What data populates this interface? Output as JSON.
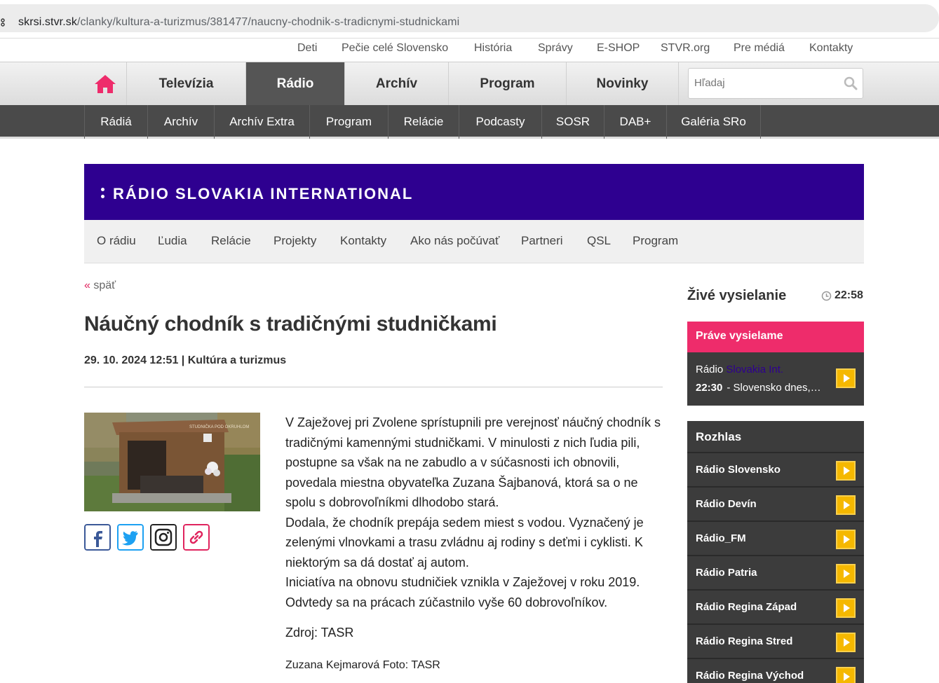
{
  "browser": {
    "url_host": "skrsi.stvr.sk",
    "url_path": "/clanky/kultura-a-turizmus/381477/naucny-chodnik-s-tradicnymi-studnickami"
  },
  "toplinks": [
    "Deti",
    "Pečie celé Slovensko",
    "História",
    "Správy",
    "E-SHOP",
    "STVR.org",
    "Pre médiá",
    "Kontakty"
  ],
  "mainnav": {
    "items": [
      "Televízia",
      "Rádio",
      "Archív",
      "Program",
      "Novinky"
    ],
    "active": "Rádio",
    "search_placeholder": "Hľadaj"
  },
  "subnav": [
    "Rádiá",
    "Archív",
    "Archív Extra",
    "Program",
    "Relácie",
    "Podcasty",
    "SOSR",
    "DAB+",
    "Galéria SRo"
  ],
  "banner": {
    "title": "RÁDIO SLOVAKIA INTERNATIONAL"
  },
  "rsinav": [
    "O rádiu",
    "Ľudia",
    "Relácie",
    "Projekty",
    "Kontakty",
    "Ako nás počúvať",
    "Partneri",
    "QSL",
    "Program"
  ],
  "article": {
    "back_arrow": "«",
    "back_label": "späť",
    "title": "Náučný chodník s tradičnými studničkami",
    "date": "29. 10. 2024 12:51",
    "separator": "|",
    "category": "Kultúra a turizmus",
    "paragraphs": [
      "V Zaježovej pri Zvolene sprístupnili pre verejnosť náučný chodník s tradičnými kamennými studničkami. V minulosti z nich ľudia pili, postupne sa však na ne zabudlo a v súčasnosti ich obnovili, povedala miestna obyvateľka Zuzana Šajbanová, ktorá sa o ne spolu s dobrovoľníkmi dlhodobo stará.",
      "Dodala, že chodník prepája sedem miest s vodou. Vyznačený je zelenými vlnovkami a trasu zvládnu aj rodiny s deťmi i cyklisti. K niektorým sa dá dostať aj autom.",
      "Iniciatíva na obnovu studničiek vznikla v Zaježovej v roku 2019. Odvtedy sa na prácach zúčastnilo vyše 60 dobrovoľníkov."
    ],
    "source": "Zdroj: TASR",
    "author": "Zuzana Kejmarová Foto: TASR",
    "photo_sign": "STUDNIČKA POD OKRUHLOM"
  },
  "share_icons": [
    "facebook-icon",
    "twitter-icon",
    "instagram-icon",
    "link-icon"
  ],
  "sidebar": {
    "live_title": "Živé vysielanie",
    "live_time": "22:58",
    "onair_header": "Práve vysielame",
    "onair_station_prefix": "Rádio",
    "onair_station_highlight": "Slovakia Int.",
    "onair_time": "22:30",
    "onair_program": "- Slovensko dnes, ...",
    "rozhlas_header": "Rozhlas",
    "stations": [
      "Rádio Slovensko",
      "Rádio Devín",
      "Rádio_FM",
      "Rádio Patria",
      "Rádio Regina Západ",
      "Rádio Regina Stred",
      "Rádio Regina Východ"
    ]
  },
  "colors": {
    "accent_pink": "#ee2c6b",
    "rsi_purple": "#2e0090",
    "play_yellow": "#f5b800",
    "dark_nav": "#4a4a4a"
  }
}
